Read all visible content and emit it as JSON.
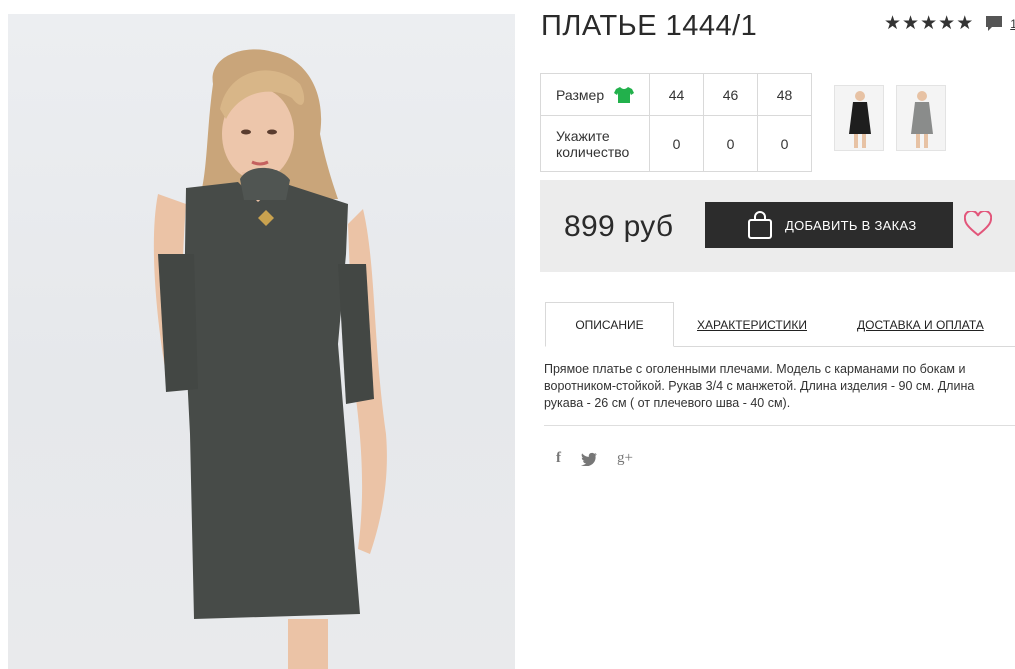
{
  "product": {
    "title": "ПЛАТЬЕ 1444/1",
    "rating_stars": 5,
    "reviews_count": "1",
    "price": "899 руб"
  },
  "size_table": {
    "size_label": "Размер",
    "qty_label": "Укажите количество",
    "sizes": [
      "44",
      "46",
      "48"
    ],
    "quantities": [
      "0",
      "0",
      "0"
    ]
  },
  "buy": {
    "add_button_label": "ДОБАВИТЬ В ЗАКАЗ"
  },
  "tabs": [
    {
      "label": "ОПИСАНИЕ",
      "active": true
    },
    {
      "label": "ХАРАКТЕРИСТИКИ",
      "active": false
    },
    {
      "label": "ДОСТАВКА И ОПЛАТА",
      "active": false
    }
  ],
  "description": "Прямое платье с оголенными плечами. Модель с карманами по бокам и воротником-стойкой. Рукав 3/4 с манжетой. Длина изделия - 90 см. Длина рукава - 26 см ( от плечевого шва - 40 см).",
  "social": {
    "facebook": "f",
    "google_plus": "g+"
  },
  "colors": {
    "dark_button": "#2c2c2c",
    "heart": "#e2557a",
    "size_icon": "#22b14c",
    "dress": "#474b48"
  },
  "icons": [
    "star-icon",
    "comment-icon",
    "shirt-icon",
    "bag-icon",
    "heart-icon",
    "facebook-icon",
    "twitter-icon",
    "google-plus-icon"
  ]
}
